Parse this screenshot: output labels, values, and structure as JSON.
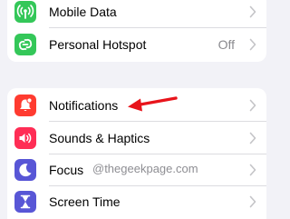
{
  "settings_top": {
    "items": [
      {
        "label": "Mobile Data",
        "icon": "antenna-icon",
        "color": "#34c759"
      },
      {
        "label": "Personal Hotspot",
        "value": "Off",
        "icon": "chain-link-icon",
        "color": "#34c759"
      }
    ]
  },
  "settings_bottom": {
    "items": [
      {
        "label": "Notifications",
        "icon": "bell-icon",
        "color": "#ff3b30"
      },
      {
        "label": "Sounds & Haptics",
        "icon": "speaker-icon",
        "color": "#ff2d55"
      },
      {
        "label": "Focus",
        "icon": "moon-icon",
        "color": "#5856d6"
      },
      {
        "label": "Screen Time",
        "icon": "hourglass-icon",
        "color": "#5856d6"
      }
    ]
  },
  "watermark": "@thegeekpage.com",
  "annotation": {
    "icon": "red-arrow-icon",
    "color": "#e8141b"
  },
  "colors": {
    "background": "#f2f2f7",
    "chevron": "#c4c4c7",
    "secondary_text": "#8a8a8e"
  }
}
